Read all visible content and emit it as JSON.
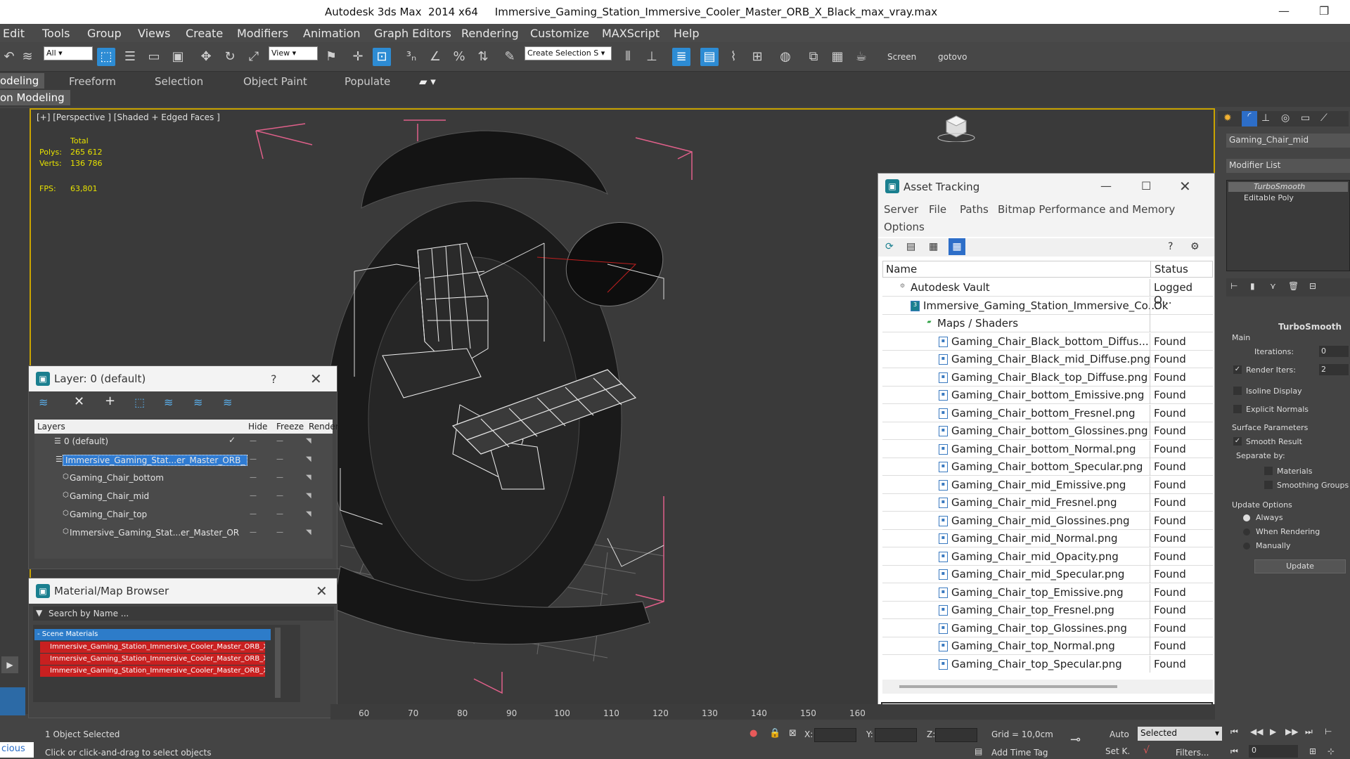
{
  "window": {
    "title": "Autodesk 3ds Max  2014 x64     Immersive_Gaming_Station_Immersive_Cooler_Master_ORB_X_Black_max_vray.max"
  },
  "menu": [
    "Edit",
    "Tools",
    "Group",
    "Views",
    "Create",
    "Modifiers",
    "Animation",
    "Graph Editors",
    "Rendering",
    "Customize",
    "MAXScript",
    "Help"
  ],
  "toolbar": {
    "filter": "All",
    "ref_coord": "View",
    "selection_set": "Create Selection S",
    "screen": "Screen",
    "gotovo": "gotovo"
  },
  "ribbon": {
    "tabs": [
      "odeling",
      "Freeform",
      "Selection",
      "Object Paint",
      "Populate"
    ],
    "sub": "on Modeling"
  },
  "viewport": {
    "label": "[+] [Perspective ] [Shaded + Edged Faces ]",
    "stats": {
      "total": "Total",
      "polys_label": "Polys:",
      "polys": "265 612",
      "verts_label": "Verts:",
      "verts": "136 786",
      "fps_label": "FPS:",
      "fps": "63,801"
    }
  },
  "layer_dialog": {
    "title": "Layer: 0 (default)",
    "help": "?",
    "headers": {
      "layers": "Layers",
      "hide": "Hide",
      "freeze": "Freeze",
      "render": "Render"
    },
    "rows": [
      {
        "name": "0 (default)",
        "selected": false
      },
      {
        "name": "Immersive_Gaming_Stat...er_Master_ORB_",
        "selected": true
      },
      {
        "name": "Gaming_Chair_bottom",
        "selected": false
      },
      {
        "name": "Gaming_Chair_mid",
        "selected": false
      },
      {
        "name": "Gaming_Chair_top",
        "selected": false
      },
      {
        "name": "Immersive_Gaming_Stat...er_Master_OR",
        "selected": false
      }
    ]
  },
  "material_browser": {
    "title": "Material/Map Browser",
    "search": "Search by Name ...",
    "group": "- Scene Materials",
    "items": [
      "Immersive_Gaming_Station_Immersive_Cooler_Master_ORB_X_Blac...",
      "Immersive_Gaming_Station_Immersive_Cooler_Master_ORB_X_Blac...",
      "Immersive_Gaming_Station_Immersive_Cooler_Master_ORB_X_Blac..."
    ]
  },
  "asset_tracking": {
    "title": "Asset Tracking",
    "menu": [
      "Server",
      "File",
      "Paths",
      "Bitmap Performance and Memory",
      "Options"
    ],
    "col_name": "Name",
    "col_status": "Status",
    "rows": [
      {
        "name": "Autodesk Vault",
        "status": "Logged O...",
        "indent": 0
      },
      {
        "name": "Immersive_Gaming_Station_Immersive_Co...",
        "status": "Ok",
        "indent": 1
      },
      {
        "name": "Maps / Shaders",
        "status": "",
        "indent": 2
      },
      {
        "name": "Gaming_Chair_Black_bottom_Diffus...",
        "status": "Found",
        "indent": 3
      },
      {
        "name": "Gaming_Chair_Black_mid_Diffuse.png",
        "status": "Found",
        "indent": 3
      },
      {
        "name": "Gaming_Chair_Black_top_Diffuse.png",
        "status": "Found",
        "indent": 3
      },
      {
        "name": "Gaming_Chair_bottom_Emissive.png",
        "status": "Found",
        "indent": 3
      },
      {
        "name": "Gaming_Chair_bottom_Fresnel.png",
        "status": "Found",
        "indent": 3
      },
      {
        "name": "Gaming_Chair_bottom_Glossines.png",
        "status": "Found",
        "indent": 3
      },
      {
        "name": "Gaming_Chair_bottom_Normal.png",
        "status": "Found",
        "indent": 3
      },
      {
        "name": "Gaming_Chair_bottom_Specular.png",
        "status": "Found",
        "indent": 3
      },
      {
        "name": "Gaming_Chair_mid_Emissive.png",
        "status": "Found",
        "indent": 3
      },
      {
        "name": "Gaming_Chair_mid_Fresnel.png",
        "status": "Found",
        "indent": 3
      },
      {
        "name": "Gaming_Chair_mid_Glossines.png",
        "status": "Found",
        "indent": 3
      },
      {
        "name": "Gaming_Chair_mid_Normal.png",
        "status": "Found",
        "indent": 3
      },
      {
        "name": "Gaming_Chair_mid_Opacity.png",
        "status": "Found",
        "indent": 3
      },
      {
        "name": "Gaming_Chair_mid_Specular.png",
        "status": "Found",
        "indent": 3
      },
      {
        "name": "Gaming_Chair_top_Emissive.png",
        "status": "Found",
        "indent": 3
      },
      {
        "name": "Gaming_Chair_top_Fresnel.png",
        "status": "Found",
        "indent": 3
      },
      {
        "name": "Gaming_Chair_top_Glossines.png",
        "status": "Found",
        "indent": 3
      },
      {
        "name": "Gaming_Chair_top_Normal.png",
        "status": "Found",
        "indent": 3
      },
      {
        "name": "Gaming_Chair_top_Specular.png",
        "status": "Found",
        "indent": 3
      }
    ]
  },
  "command_panel": {
    "object_name": "Gaming_Chair_mid",
    "modifier_list": "Modifier List",
    "stack": [
      "TurboSmooth",
      "Editable Poly"
    ],
    "rollout": "TurboSmooth",
    "main": "Main",
    "iterations_label": "Iterations:",
    "iterations": "0",
    "render_iters_label": "Render Iters:",
    "render_iters": "2",
    "isoline": "Isoline Display",
    "explicit": "Explicit Normals",
    "surface": "Surface Parameters",
    "smooth": "Smooth Result",
    "separate": "Separate by:",
    "materials": "Materials",
    "smoothing": "Smoothing Groups",
    "update_options": "Update Options",
    "always": "Always",
    "when_rendering": "When Rendering",
    "manually": "Manually",
    "update": "Update"
  },
  "timeline": {
    "ticks": [
      "60",
      "70",
      "80",
      "90",
      "100",
      "110",
      "120",
      "130",
      "140",
      "150",
      "160"
    ]
  },
  "status": {
    "selected": "1 Object Selected",
    "hint": "Click or click-and-drag to select objects",
    "x": "X:",
    "y": "Y:",
    "z": "Z:",
    "grid": "Grid = 10,0cm",
    "add_time_tag": "Add Time Tag",
    "auto": "Auto",
    "set_k": "Set K.",
    "key_mode": "Selected",
    "filters": "Filters...",
    "frame": "0",
    "maxscript": "cious"
  }
}
